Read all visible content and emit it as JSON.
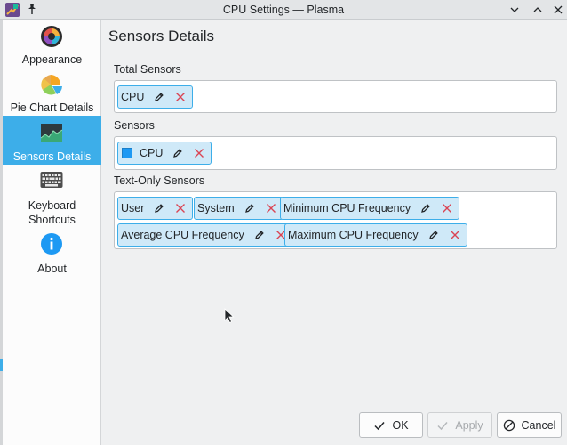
{
  "window": {
    "title": "CPU Settings — Plasma"
  },
  "sidebar": {
    "items": [
      {
        "label": "Appearance",
        "icon": "appearance-icon"
      },
      {
        "label": "Pie Chart Details",
        "icon": "pie-chart-icon"
      },
      {
        "label": "Sensors Details",
        "icon": "sensors-chart-icon",
        "active": true
      },
      {
        "label_line1": "Keyboard",
        "label_line2": "Shortcuts",
        "icon": "keyboard-icon"
      },
      {
        "label": "About",
        "icon": "info-icon"
      }
    ]
  },
  "page": {
    "title": "Sensors Details",
    "total_sensors": {
      "label": "Total Sensors",
      "chips": [
        "CPU"
      ]
    },
    "sensors": {
      "label": "Sensors",
      "chips": [
        {
          "text": "CPU",
          "color": "#1d99f3"
        }
      ]
    },
    "text_only_sensors": {
      "label": "Text-Only Sensors",
      "chips": [
        "User",
        "System",
        "Minimum CPU Frequency",
        "Average CPU Frequency",
        "Maximum CPU Frequency"
      ]
    }
  },
  "footer": {
    "ok": "OK",
    "apply": "Apply",
    "cancel": "Cancel"
  },
  "colors": {
    "accent": "#3daee9",
    "chip_bg": "#cfe9f8",
    "remove_red": "#da4453"
  }
}
